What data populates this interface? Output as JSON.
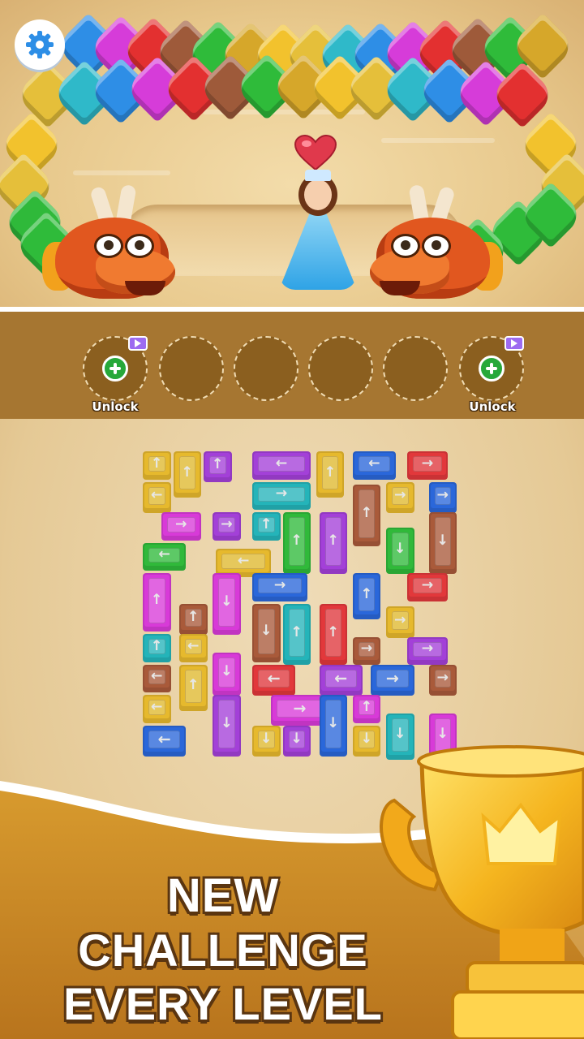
{
  "header": {
    "settings_icon": "gear-icon"
  },
  "scene": {
    "heart_icon": "heart-icon",
    "dragon_colors": [
      "#e1571f",
      "#f07a30"
    ],
    "spike_colors": [
      "#f2c22d",
      "#e5bf3a",
      "#2fb9c9",
      "#2e8ee6",
      "#d63cd9",
      "#e33030",
      "#9e5a3a",
      "#2fbb3a",
      "#d6a72a"
    ]
  },
  "slots": {
    "items": [
      {
        "state": "locked",
        "label": "Unlock",
        "icon": "plus-icon",
        "badge": "video-icon"
      },
      {
        "state": "empty"
      },
      {
        "state": "empty"
      },
      {
        "state": "empty"
      },
      {
        "state": "empty"
      },
      {
        "state": "locked",
        "label": "Unlock",
        "icon": "plus-icon",
        "badge": "video-icon"
      }
    ]
  },
  "colors": {
    "yellow": "#e6b72d",
    "purple": "#a23fd6",
    "red": "#e0373b",
    "blue": "#2a66d8",
    "teal": "#24b3b8",
    "brown": "#a8593a",
    "magenta": "#d63ad6",
    "green": "#2fb83a"
  },
  "board": {
    "blocks": [
      {
        "c": "yellow",
        "d": "up"
      },
      {
        "c": "yellow",
        "d": "up"
      },
      {
        "c": "purple",
        "d": "up"
      },
      {
        "c": "purple",
        "d": "left"
      },
      {
        "c": "yellow",
        "d": "up"
      },
      {
        "c": "blue",
        "d": "left"
      },
      {
        "c": "red",
        "d": "right"
      },
      {
        "c": "yellow",
        "d": "left"
      },
      {
        "c": "teal",
        "d": "right"
      },
      {
        "c": "yellow",
        "d": "right"
      },
      {
        "c": "blue",
        "d": "right"
      },
      {
        "c": "brown",
        "d": "up"
      },
      {
        "c": "magenta",
        "d": "right"
      },
      {
        "c": "purple",
        "d": "right"
      },
      {
        "c": "teal",
        "d": "up"
      },
      {
        "c": "green",
        "d": "up"
      },
      {
        "c": "purple",
        "d": "up"
      },
      {
        "c": "green",
        "d": "down"
      },
      {
        "c": "brown",
        "d": "down"
      },
      {
        "c": "green",
        "d": "left"
      },
      {
        "c": "yellow",
        "d": "left"
      },
      {
        "c": "magenta",
        "d": "up"
      },
      {
        "c": "magenta",
        "d": "down"
      },
      {
        "c": "blue",
        "d": "right"
      },
      {
        "c": "blue",
        "d": "up"
      },
      {
        "c": "red",
        "d": "right"
      },
      {
        "c": "brown",
        "d": "down"
      },
      {
        "c": "brown",
        "d": "up"
      },
      {
        "c": "teal",
        "d": "up"
      },
      {
        "c": "red",
        "d": "up"
      },
      {
        "c": "yellow",
        "d": "right"
      },
      {
        "c": "teal",
        "d": "up"
      },
      {
        "c": "yellow",
        "d": "left"
      },
      {
        "c": "brown",
        "d": "right"
      },
      {
        "c": "purple",
        "d": "right"
      },
      {
        "c": "brown",
        "d": "left"
      },
      {
        "c": "yellow",
        "d": "up"
      },
      {
        "c": "magenta",
        "d": "down"
      },
      {
        "c": "red",
        "d": "left"
      },
      {
        "c": "purple",
        "d": "left"
      },
      {
        "c": "blue",
        "d": "right"
      },
      {
        "c": "brown",
        "d": "right"
      },
      {
        "c": "yellow",
        "d": "left"
      },
      {
        "c": "purple",
        "d": "down"
      },
      {
        "c": "magenta",
        "d": "right"
      },
      {
        "c": "blue",
        "d": "down"
      },
      {
        "c": "magenta",
        "d": "up"
      },
      {
        "c": "blue",
        "d": "left"
      },
      {
        "c": "yellow",
        "d": "down"
      },
      {
        "c": "purple",
        "d": "down"
      },
      {
        "c": "yellow",
        "d": "down"
      },
      {
        "c": "teal",
        "d": "down"
      },
      {
        "c": "magenta",
        "d": "down"
      }
    ]
  },
  "promo": {
    "line1": "NEW",
    "line2": "CHALLENGE",
    "line3": "EVERY LEVEL",
    "trophy_icon": "trophy-icon"
  }
}
